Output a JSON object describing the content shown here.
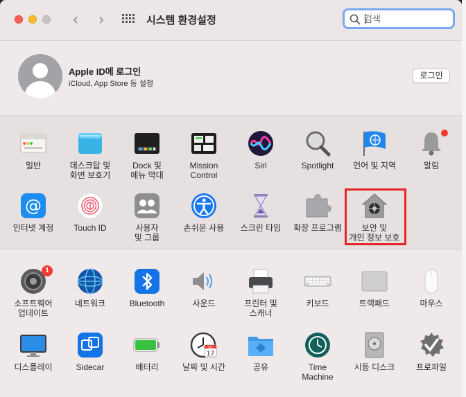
{
  "window": {
    "title": "시스템 환경설정",
    "back_glyph": "‹",
    "forward_glyph": "›"
  },
  "search": {
    "placeholder": "검색",
    "value": ""
  },
  "account": {
    "title": "Apple ID에 로그인",
    "subtitle": "iCloud, App Store 등 설정",
    "login_label": "로그인"
  },
  "prefs_row1": [
    {
      "label": "일반",
      "icon": "general-icon"
    },
    {
      "label": "데스크탑 및\n화면 보호기",
      "icon": "desktop-screensaver-icon"
    },
    {
      "label": "Dock 및\n메뉴 막대",
      "icon": "dock-icon"
    },
    {
      "label": "Mission\nControl",
      "icon": "mission-control-icon"
    },
    {
      "label": "Siri",
      "icon": "siri-icon"
    },
    {
      "label": "Spotlight",
      "icon": "spotlight-icon"
    },
    {
      "label": "언어 및 지역",
      "icon": "language-region-icon"
    },
    {
      "label": "알림",
      "icon": "notifications-icon"
    }
  ],
  "prefs_row2": [
    {
      "label": "인터넷 계정",
      "icon": "internet-accounts-icon"
    },
    {
      "label": "Touch ID",
      "icon": "touch-id-icon"
    },
    {
      "label": "사용자\n및 그룹",
      "icon": "users-groups-icon"
    },
    {
      "label": "손쉬운 사용",
      "icon": "accessibility-icon"
    },
    {
      "label": "스크린 타임",
      "icon": "screen-time-icon"
    },
    {
      "label": "확장 프로그램",
      "icon": "extensions-icon"
    },
    {
      "label": "보안 및\n개인 정보 보호",
      "icon": "security-privacy-icon"
    }
  ],
  "prefs_row3": [
    {
      "label": "소프트웨어\n업데이트",
      "icon": "software-update-icon",
      "badge": "1"
    },
    {
      "label": "네트워크",
      "icon": "network-icon"
    },
    {
      "label": "Bluetooth",
      "icon": "bluetooth-icon"
    },
    {
      "label": "사운드",
      "icon": "sound-icon"
    },
    {
      "label": "프린터 및\n스캐너",
      "icon": "printers-scanners-icon"
    },
    {
      "label": "키보드",
      "icon": "keyboard-icon"
    },
    {
      "label": "트랙패드",
      "icon": "trackpad-icon"
    },
    {
      "label": "마우스",
      "icon": "mouse-icon"
    }
  ],
  "prefs_row4": [
    {
      "label": "디스플레이",
      "icon": "displays-icon"
    },
    {
      "label": "Sidecar",
      "icon": "sidecar-icon"
    },
    {
      "label": "배터리",
      "icon": "battery-icon"
    },
    {
      "label": "날짜 및 시간",
      "icon": "date-time-icon",
      "day": "17",
      "month": "JUL"
    },
    {
      "label": "공유",
      "icon": "sharing-icon"
    },
    {
      "label": "Time\nMachine",
      "icon": "time-machine-icon"
    },
    {
      "label": "시동 디스크",
      "icon": "startup-disk-icon"
    },
    {
      "label": "프로파일",
      "icon": "profiles-icon"
    }
  ],
  "colors": {
    "accent_blue": "#1a78f2",
    "highlight_red": "#e3261f",
    "badge_red": "#f23b30"
  }
}
